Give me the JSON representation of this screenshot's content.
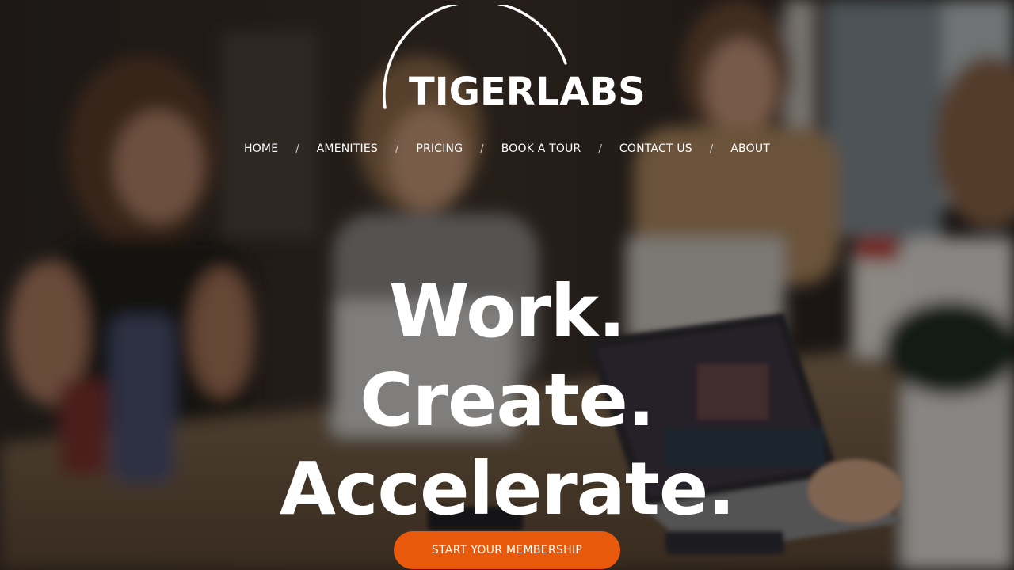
{
  "brand": {
    "name": "TIGERLABS",
    "logo_arc_color": "#ffffff"
  },
  "nav": {
    "items": [
      {
        "label": "HOME"
      },
      {
        "label": "AMENITIES"
      },
      {
        "label": "PRICING"
      },
      {
        "label": "BOOK A TOUR"
      },
      {
        "label": "CONTACT US"
      },
      {
        "label": "ABOUT"
      }
    ],
    "separator": "/"
  },
  "hero": {
    "lines": [
      "Work.",
      "Create.",
      "Accelerate."
    ],
    "background_description_icon": "coworking-photo",
    "cta_label": "START YOUR MEMBERSHIP",
    "cta_color": "#e8590c"
  }
}
